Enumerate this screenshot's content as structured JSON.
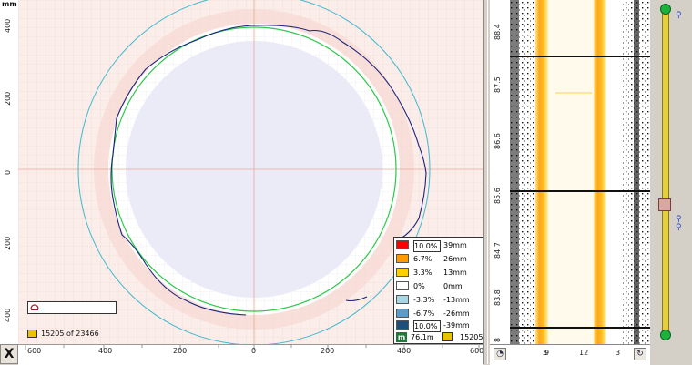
{
  "ruler": {
    "unit": "mm",
    "vertical_ticks": [
      "400",
      "200",
      "0",
      "200",
      "400"
    ],
    "horizontal_ticks": [
      "600",
      "400",
      "200",
      "0",
      "200",
      "400",
      "600"
    ]
  },
  "corner_button": "X",
  "legend": {
    "rows": [
      {
        "color": "#ff0000",
        "pct": "10.0%",
        "mm": "39mm",
        "boxed": true
      },
      {
        "color": "#ff9900",
        "pct": "6.7%",
        "mm": "26mm",
        "boxed": false
      },
      {
        "color": "#ffd000",
        "pct": "3.3%",
        "mm": "13mm",
        "boxed": false
      },
      {
        "color": "#ffffff",
        "pct": "0%",
        "mm": "0mm",
        "boxed": false
      },
      {
        "color": "#a9d6e5",
        "pct": "-3.3%",
        "mm": "-13mm",
        "boxed": false
      },
      {
        "color": "#5b9cc9",
        "pct": "-6.7%",
        "mm": "-26mm",
        "boxed": false
      },
      {
        "color": "#1f4e79",
        "pct": "10.0%",
        "mm": "-39mm",
        "boxed": true
      }
    ],
    "footer_icon": "m",
    "footer_distance": "76.1m",
    "footer_frame": "15205"
  },
  "frame_counter": "15205 of 23466",
  "strip": {
    "distance_ticks": [
      "88.4",
      "87.5",
      "86.6",
      "85.6",
      "84.7",
      "83.8",
      "8"
    ],
    "bottom_ticks": [
      "3",
      "9",
      "12",
      "3"
    ]
  },
  "colors": {
    "circle_outer": "#40b8d0",
    "circle_green": "#2cc84a",
    "profile": "#1a237e",
    "inner_fill": "#ebebf8",
    "background": "#fbeeea"
  },
  "icons": {
    "status": "profile-icon",
    "frame": "film-icon",
    "compass": "compass-icon",
    "rotate": "rotate-icon"
  }
}
